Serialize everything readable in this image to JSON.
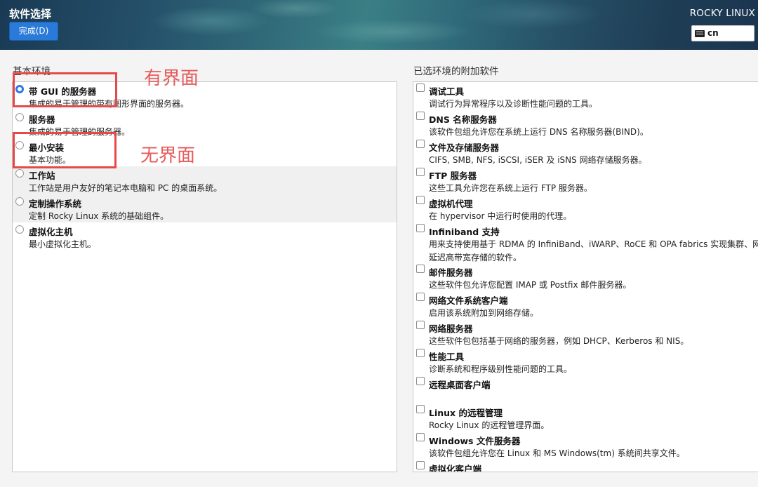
{
  "header": {
    "title": "软件选择",
    "done_label": "完成(D)",
    "product": "ROCKY LINUX",
    "keyboard_layout": "cn",
    "keyboard_icon": "keyboard-icon"
  },
  "base_env": {
    "title": "基本环境",
    "items": [
      {
        "name": "带 GUI 的服务器",
        "desc": "集成的易于管理的带有图形界面的服务器。",
        "selected": true
      },
      {
        "name": "服务器",
        "desc": "集成的易于管理的服务器。",
        "selected": false
      },
      {
        "name": "最小安装",
        "desc": "基本功能。",
        "selected": false
      },
      {
        "name": "工作站",
        "desc": "工作站是用户友好的笔记本电脑和 PC 的桌面系统。",
        "selected": false
      },
      {
        "name": "定制操作系统",
        "desc": "定制 Rocky Linux 系统的基础组件。",
        "selected": false
      },
      {
        "name": "虚拟化主机",
        "desc": "最小虚拟化主机。",
        "selected": false
      }
    ]
  },
  "addons": {
    "title": "已选环境的附加软件",
    "items": [
      {
        "name": "调试工具",
        "desc": "调试行为异常程序以及诊断性能问题的工具。",
        "checked": false
      },
      {
        "name": "DNS 名称服务器",
        "desc": "该软件包组允许您在系统上运行 DNS 名称服务器(BIND)。",
        "checked": false
      },
      {
        "name": "文件及存储服务器",
        "desc": "CIFS, SMB, NFS, iSCSI, iSER 及 iSNS 网络存储服务器。",
        "checked": false
      },
      {
        "name": "FTP 服务器",
        "desc": "这些工具允许您在系统上运行 FTP 服务器。",
        "checked": false
      },
      {
        "name": "虚拟机代理",
        "desc": "在 hypervisor 中运行时使用的代理。",
        "checked": false
      },
      {
        "name": "Infiniband 支持",
        "desc": "用来支持使用基于 RDMA 的 InfiniBand、iWARP、RoCE 和 OPA fabrics 实现集群、网格连",
        "desc2": "延迟高带宽存储的软件。",
        "checked": false
      },
      {
        "name": "邮件服务器",
        "desc": "这些软件包允许您配置 IMAP 或 Postfix 邮件服务器。",
        "checked": false
      },
      {
        "name": "网络文件系统客户端",
        "desc": "启用该系统附加到网络存储。",
        "checked": false
      },
      {
        "name": "网络服务器",
        "desc": "这些软件包包括基于网络的服务器，例如 DHCP、Kerberos 和 NIS。",
        "checked": false
      },
      {
        "name": "性能工具",
        "desc": "诊断系统和程序级别性能问题的工具。",
        "checked": false
      },
      {
        "name": "远程桌面客户端",
        "desc": "",
        "checked": false
      },
      {
        "name": "Linux 的远程管理",
        "desc": "Rocky Linux 的远程管理界面。",
        "checked": false
      },
      {
        "name": "Windows 文件服务器",
        "desc": "该软件包组允许您在 Linux 和 MS Windows(tm) 系统间共享文件。",
        "checked": false
      },
      {
        "name": "虚拟化客户端",
        "desc": "",
        "checked": false
      }
    ]
  },
  "annotations": {
    "gui_label": "有界面",
    "nogui_label": "无界面",
    "color": "#e84848"
  }
}
